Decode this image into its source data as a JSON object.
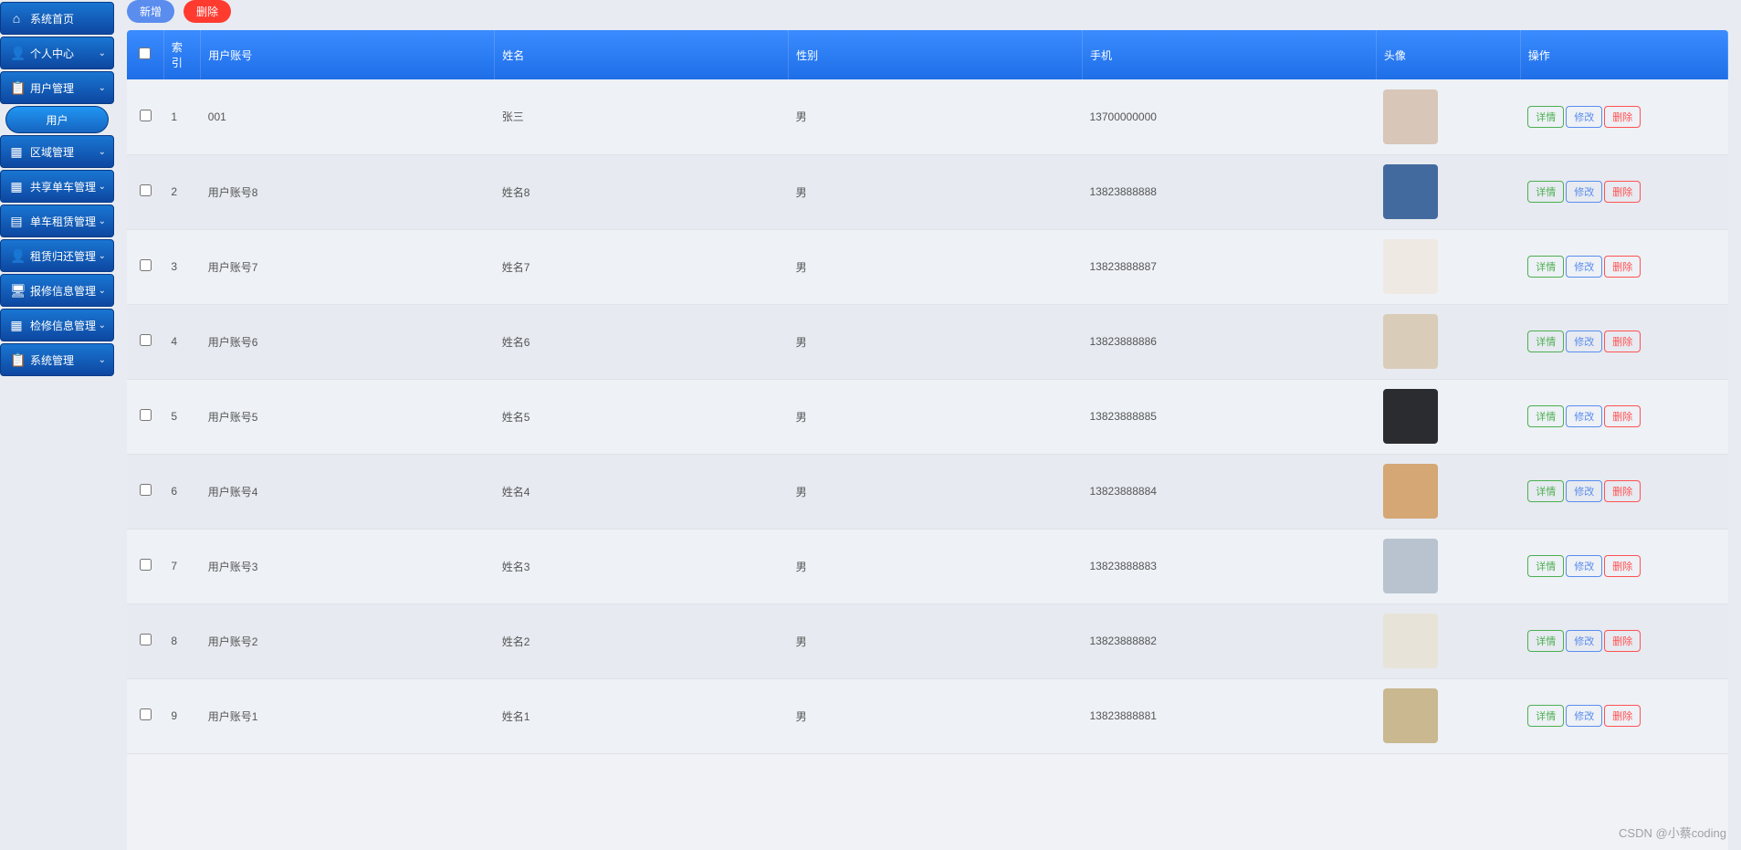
{
  "sidebar": {
    "items": [
      {
        "icon": "⌂",
        "label": "系统首页",
        "expand": false
      },
      {
        "icon": "👤",
        "label": "个人中心",
        "expand": true
      },
      {
        "icon": "📋",
        "label": "用户管理",
        "expand": true
      },
      {
        "icon": "",
        "label": "用户",
        "sub": true
      },
      {
        "icon": "▦",
        "label": "区域管理",
        "expand": true
      },
      {
        "icon": "▦",
        "label": "共享单车管理",
        "expand": true
      },
      {
        "icon": "▤",
        "label": "单车租赁管理",
        "expand": true
      },
      {
        "icon": "👤",
        "label": "租赁归还管理",
        "expand": true
      },
      {
        "icon": "🖥",
        "label": "报修信息管理",
        "expand": true
      },
      {
        "icon": "▦",
        "label": "检修信息管理",
        "expand": true
      },
      {
        "icon": "📋",
        "label": "系统管理",
        "expand": true
      }
    ]
  },
  "toolbar": {
    "add_label": "新增",
    "delete_label": "删除"
  },
  "table": {
    "headers": {
      "index": "索引",
      "account": "用户账号",
      "name": "姓名",
      "gender": "性别",
      "phone": "手机",
      "avatar": "头像",
      "ops": "操作"
    },
    "rows": [
      {
        "index": "1",
        "account": "001",
        "name": "张三",
        "gender": "男",
        "phone": "13700000000",
        "avatar_bg": "#d8c6b8"
      },
      {
        "index": "2",
        "account": "用户账号8",
        "name": "姓名8",
        "gender": "男",
        "phone": "13823888888",
        "avatar_bg": "#436a9f"
      },
      {
        "index": "3",
        "account": "用户账号7",
        "name": "姓名7",
        "gender": "男",
        "phone": "13823888887",
        "avatar_bg": "#efe9e3"
      },
      {
        "index": "4",
        "account": "用户账号6",
        "name": "姓名6",
        "gender": "男",
        "phone": "13823888886",
        "avatar_bg": "#d9cdb9"
      },
      {
        "index": "5",
        "account": "用户账号5",
        "name": "姓名5",
        "gender": "男",
        "phone": "13823888885",
        "avatar_bg": "#2b2c30"
      },
      {
        "index": "6",
        "account": "用户账号4",
        "name": "姓名4",
        "gender": "男",
        "phone": "13823888884",
        "avatar_bg": "#d4a774"
      },
      {
        "index": "7",
        "account": "用户账号3",
        "name": "姓名3",
        "gender": "男",
        "phone": "13823888883",
        "avatar_bg": "#b8c3cf"
      },
      {
        "index": "8",
        "account": "用户账号2",
        "name": "姓名2",
        "gender": "男",
        "phone": "13823888882",
        "avatar_bg": "#e7e3d8"
      },
      {
        "index": "9",
        "account": "用户账号1",
        "name": "姓名1",
        "gender": "男",
        "phone": "13823888881",
        "avatar_bg": "#c9b890"
      }
    ],
    "op_labels": {
      "detail": "详情",
      "edit": "修改",
      "delete": "删除"
    }
  },
  "watermark": "CSDN @小蔡coding"
}
